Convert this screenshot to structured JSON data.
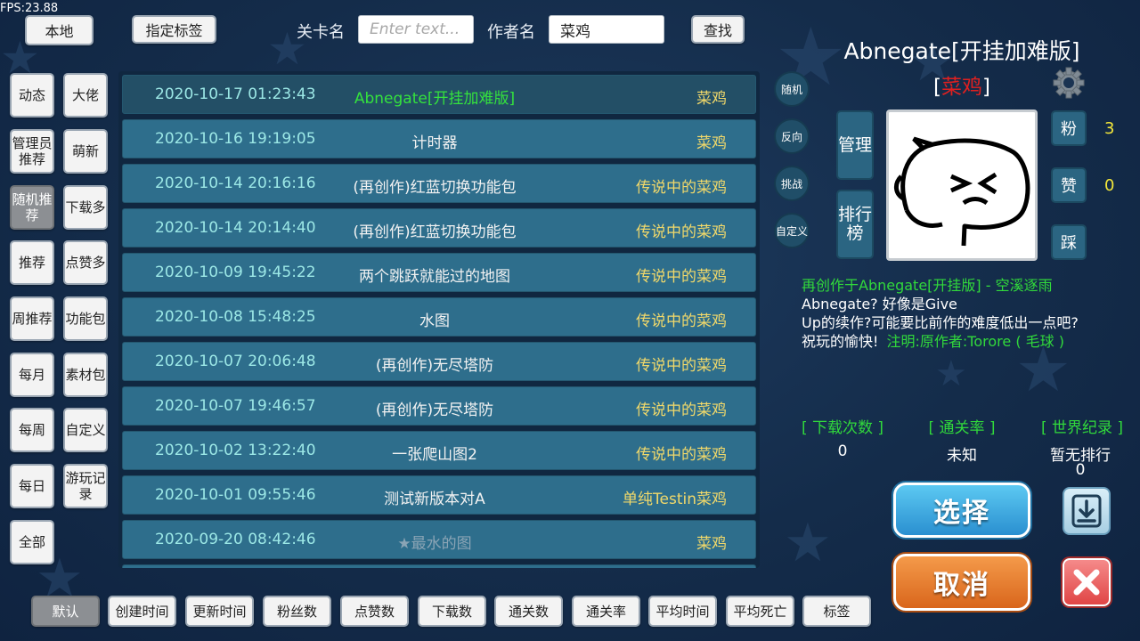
{
  "fps": "FPS:23.88",
  "top": {
    "local_btn": "本地",
    "tag_btn": "指定标签",
    "level_label": "关卡名",
    "level_placeholder": "Enter text...",
    "author_label": "作者名",
    "author_value": "菜鸡",
    "search_btn": "查找"
  },
  "left_col1": [
    "动态",
    "管理员推荐",
    "随机推荐",
    "推荐",
    "周推荐",
    "每月",
    "每周",
    "每日",
    "全部"
  ],
  "left_col2": [
    "大佬",
    "萌新",
    "下载多",
    "点赞多",
    "功能包",
    "素材包",
    "自定义",
    "游玩记录"
  ],
  "levels": [
    {
      "date": "2020-10-17 01:23:43",
      "title": "Abnegate[开挂加难版]",
      "author": "菜鸡"
    },
    {
      "date": "2020-10-16 19:19:05",
      "title": "计时器",
      "author": "菜鸡"
    },
    {
      "date": "2020-10-14 20:16:16",
      "title": "(再创作)红蓝切换功能包",
      "author": "传说中的菜鸡"
    },
    {
      "date": "2020-10-14 20:14:40",
      "title": "(再创作)红蓝切换功能包",
      "author": "传说中的菜鸡"
    },
    {
      "date": "2020-10-09 19:45:22",
      "title": "两个跳跃就能过的地图",
      "author": "传说中的菜鸡"
    },
    {
      "date": "2020-10-08 15:48:25",
      "title": "水图",
      "author": "传说中的菜鸡"
    },
    {
      "date": "2020-10-07 20:06:48",
      "title": "(再创作)无尽塔防",
      "author": "传说中的菜鸡"
    },
    {
      "date": "2020-10-07 19:46:57",
      "title": "(再创作)无尽塔防",
      "author": "传说中的菜鸡"
    },
    {
      "date": "2020-10-02 13:22:40",
      "title": "一张爬山图2",
      "author": "传说中的菜鸡"
    },
    {
      "date": "2020-10-01 09:55:46",
      "title": "测试新版本对A",
      "author": "单纯Testin菜鸡"
    },
    {
      "date": "2020-09-20 08:42:46",
      "title": "★最水的图",
      "author": "菜鸡"
    }
  ],
  "circle_btns": [
    "随机",
    "反向",
    "挑战",
    "自定义"
  ],
  "detail": {
    "title": "Abnegate[开挂加难版]",
    "author_bracket_l": "[",
    "author": "菜鸡",
    "author_bracket_r": "]",
    "manage_btn": "管理",
    "rank_btn": "排行榜",
    "fans_label": "粉",
    "fans_count": "3",
    "likes_label": "赞",
    "likes_count": "0",
    "dislike_label": "踩",
    "recreate_note": "再创作于Abnegate[开挂版] - 空溪逐雨",
    "desc_line1": "Abnegate? 好像是Give",
    "desc_line2": "Up的续作?可能要比前作的难度低出一点吧?",
    "desc_line3": "祝玩的愉快!",
    "desc_note": "注明:原作者:Torore ( 毛球 )"
  },
  "stats": {
    "downloads_label": "[ 下载次数 ]",
    "downloads_value": "0",
    "pass_rate_label": "[ 通关率 ]",
    "pass_rate_value": "未知",
    "world_record_label": "[ 世界纪录 ]",
    "world_record_value": "暂无排行",
    "world_record_sub": "0"
  },
  "actions": {
    "select": "选择",
    "cancel": "取消"
  },
  "sort_buttons": [
    "默认",
    "创建时间",
    "更新时间",
    "粉丝数",
    "点赞数",
    "下载数",
    "通关数",
    "通关率",
    "平均时间",
    "平均死亡",
    "标签"
  ],
  "colors": {
    "accent_green": "#31d93b",
    "author_red": "#e02020",
    "count_yellow": "#f2e63a",
    "row_bg": "#2e6e8c"
  }
}
